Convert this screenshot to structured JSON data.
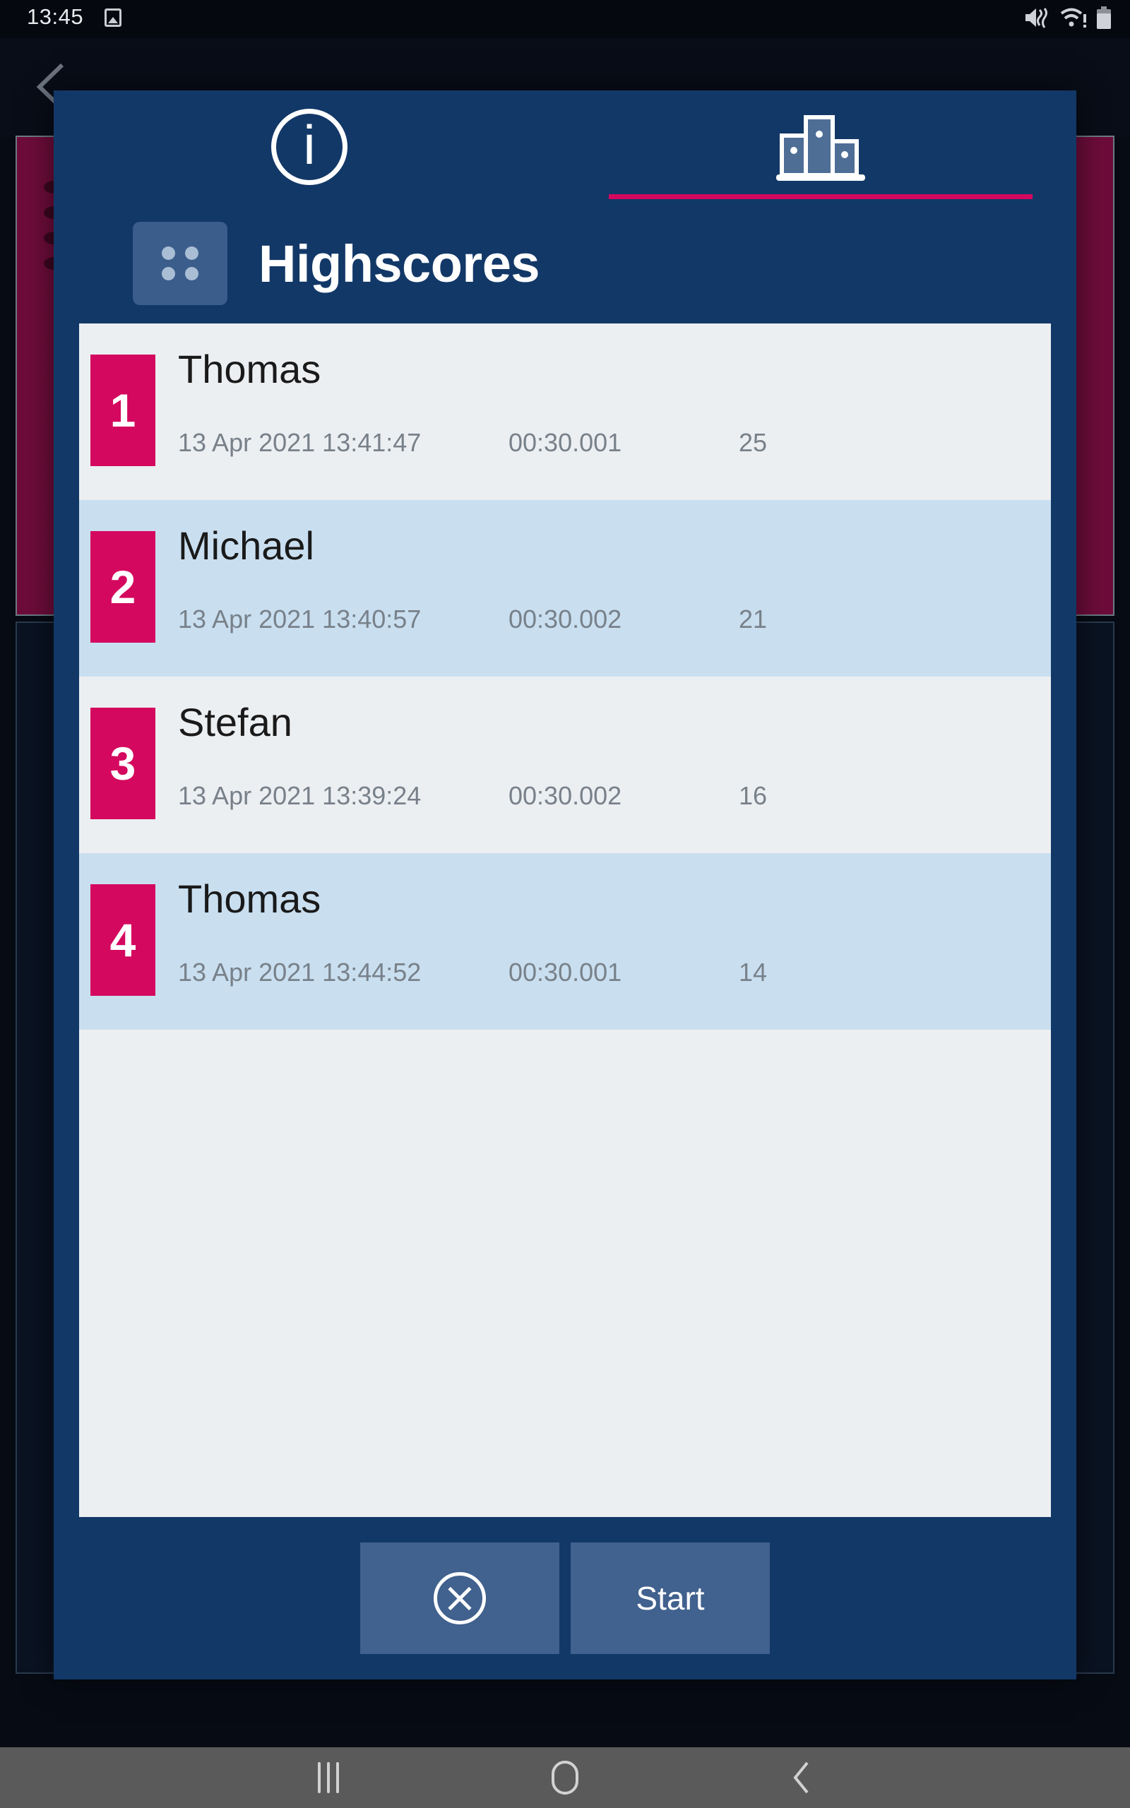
{
  "status_bar": {
    "time": "13:45",
    "icons": [
      "image-icon",
      "mute-vibrate-icon",
      "wifi-alert-icon",
      "battery-icon"
    ]
  },
  "dialog": {
    "tabs": [
      {
        "id": "info",
        "icon": "info-circle-icon",
        "label": "i",
        "active": false
      },
      {
        "id": "highscores",
        "icon": "podium-bar-chart-icon",
        "label": "",
        "active": true
      }
    ],
    "title": "Highscores",
    "grid_icon": "grid-dots-icon",
    "columns": [
      "rank",
      "name",
      "date",
      "time",
      "score"
    ],
    "rows": [
      {
        "rank": "1",
        "name": "Thomas",
        "date": "13 Apr 2021 13:41:47",
        "time": "00:30.001",
        "score": "25"
      },
      {
        "rank": "2",
        "name": "Michael",
        "date": "13 Apr 2021 13:40:57",
        "time": "00:30.002",
        "score": "21"
      },
      {
        "rank": "3",
        "name": "Stefan",
        "date": "13 Apr 2021 13:39:24",
        "time": "00:30.002",
        "score": "16"
      },
      {
        "rank": "4",
        "name": "Thomas",
        "date": "13 Apr 2021 13:44:52",
        "time": "00:30.001",
        "score": "14"
      }
    ],
    "footer": {
      "close_icon": "close-circle-icon",
      "start_label": "Start"
    }
  },
  "nav_bar": {
    "recents": "recents-icon",
    "home": "home-icon",
    "back": "back-icon"
  },
  "colors": {
    "dialog_bg": "#123867",
    "accent_pink": "#d4085f",
    "row_light": "#eceff2",
    "row_alt": "#c9dff0",
    "button_bg": "#41618e"
  }
}
